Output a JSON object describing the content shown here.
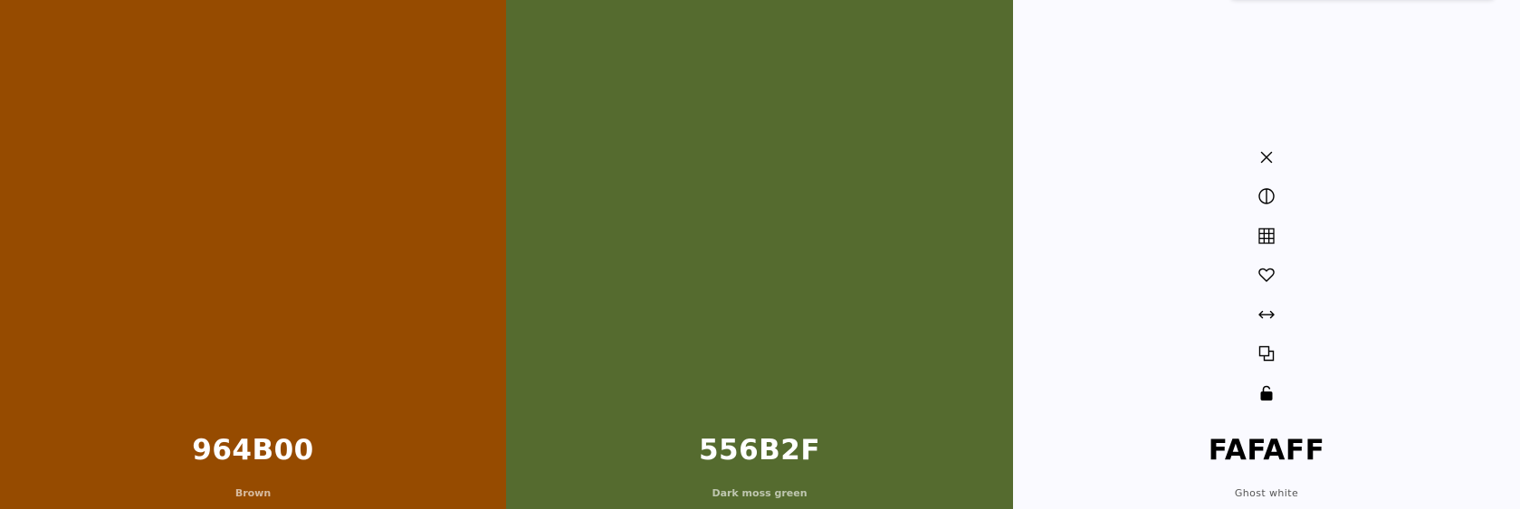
{
  "colors": [
    {
      "hex": "964B00",
      "name": "Brown",
      "bg": "#964B00",
      "tone": "light"
    },
    {
      "hex": "556B2F",
      "name": "Dark moss green",
      "bg": "#556B2F",
      "tone": "light"
    },
    {
      "hex": "FAFAFF",
      "name": "Ghost white",
      "bg": "#FAFAFF",
      "tone": "dark"
    }
  ],
  "toolbar": {
    "icons": [
      "close-icon",
      "contrast-icon",
      "grid-icon",
      "heart-icon",
      "arrows-horizontal-icon",
      "copy-icon",
      "unlock-icon"
    ]
  }
}
